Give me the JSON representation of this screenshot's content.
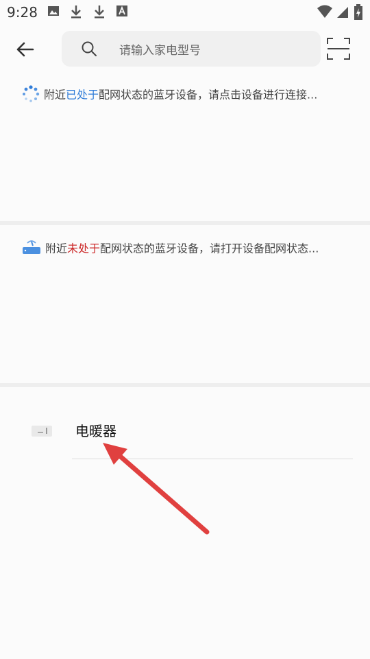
{
  "status_bar": {
    "time": "9:28",
    "icons": [
      "image-icon",
      "download-icon",
      "download-icon",
      "text-icon",
      "wifi-icon",
      "signal-icon",
      "battery-icon"
    ]
  },
  "header": {
    "search_placeholder": "请输入家电型号"
  },
  "hint_connected": {
    "before": "附近",
    "highlight": "已处于",
    "after": "配网状态的蓝牙设备，请点击设备进行连接..."
  },
  "hint_not_connected": {
    "before": "附近",
    "highlight": "未处于",
    "after": "配网状态的蓝牙设备，请打开设备配网状态..."
  },
  "device_list": [
    {
      "name": "电暖器"
    }
  ],
  "colors": {
    "blue_highlight": "#2f7cd8",
    "red_highlight": "#cc2a2a",
    "arrow": "#e0403f"
  }
}
